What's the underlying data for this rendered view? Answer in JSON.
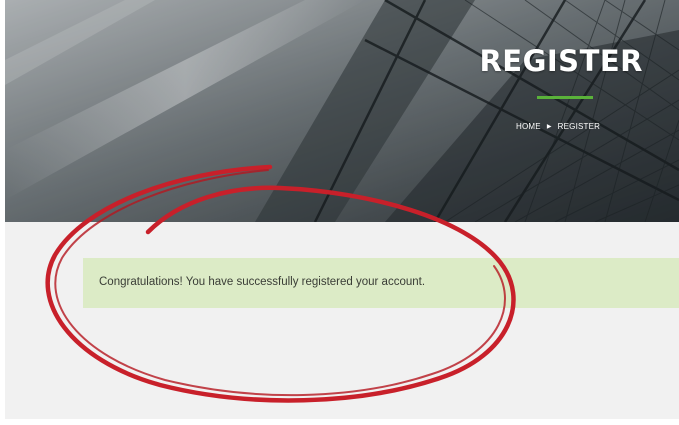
{
  "hero": {
    "title": "REGISTER",
    "accent_color": "#5ab23a",
    "breadcrumb": {
      "home": "HOME",
      "separator_icon": "triangle-right-icon",
      "current": "REGISTER"
    }
  },
  "notice": {
    "message": "Congratulations! You have successfully registered your account.",
    "background": "#dcebc6"
  },
  "annotation": {
    "type": "hand-drawn circle",
    "color": "#c8202a"
  }
}
